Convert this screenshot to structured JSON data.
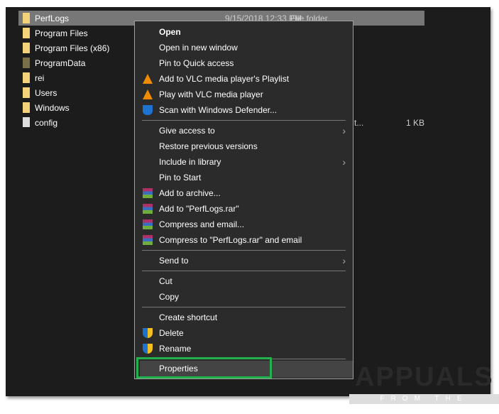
{
  "files": [
    {
      "name": "PerfLogs",
      "date": "9/15/2018 12:33 PM",
      "type": "File folder",
      "icon": "folder",
      "selected": true
    },
    {
      "name": "Program Files",
      "icon": "folder"
    },
    {
      "name": "Program Files (x86)",
      "icon": "folder"
    },
    {
      "name": "ProgramData",
      "icon": "folder-hidden"
    },
    {
      "name": "rei",
      "icon": "folder"
    },
    {
      "name": "Users",
      "icon": "folder"
    },
    {
      "name": "Windows",
      "icon": "folder"
    },
    {
      "name": "config",
      "type": "t...",
      "size": "1 KB",
      "icon": "config-file"
    }
  ],
  "menu": {
    "open": "Open",
    "open_new": "Open in new window",
    "pin_quick": "Pin to Quick access",
    "vlc_add": "Add to VLC media player's Playlist",
    "vlc_play": "Play with VLC media player",
    "defender": "Scan with Windows Defender...",
    "give_access": "Give access to",
    "restore": "Restore previous versions",
    "include": "Include in library",
    "pin_start": "Pin to Start",
    "add_archive": "Add to archive...",
    "add_rar": "Add to \"PerfLogs.rar\"",
    "compress_email": "Compress and email...",
    "compress_rar_email": "Compress to \"PerfLogs.rar\" and email",
    "send_to": "Send to",
    "cut": "Cut",
    "copy": "Copy",
    "create_shortcut": "Create shortcut",
    "delete": "Delete",
    "rename": "Rename",
    "properties": "Properties"
  },
  "watermark": {
    "brand": "APPUALS",
    "tagline": "FROM THE EXPERTS!"
  }
}
